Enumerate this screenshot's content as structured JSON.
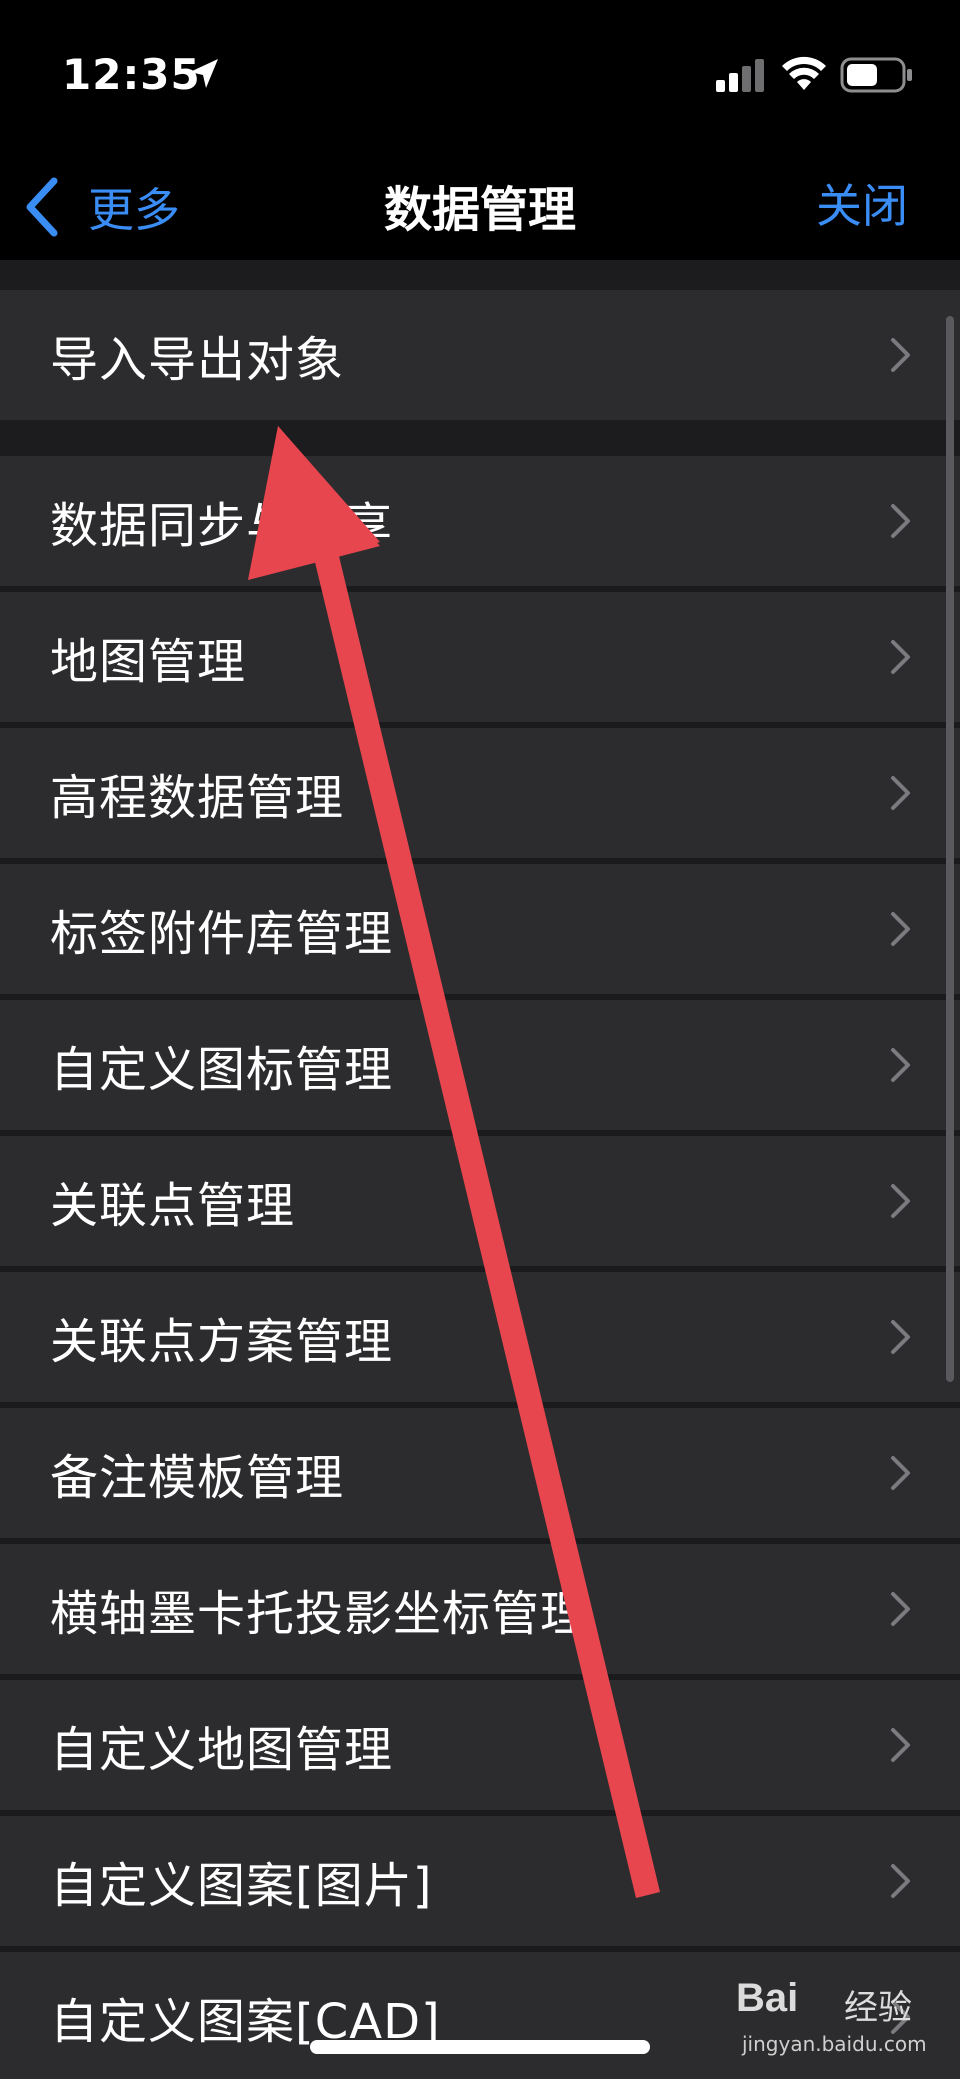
{
  "status_bar": {
    "time": "12:35",
    "icons": [
      "location-arrow-icon",
      "cellular-signal-icon",
      "wifi-icon",
      "battery-icon"
    ]
  },
  "nav": {
    "back_label": "更多",
    "title": "数据管理",
    "close_label": "关闭"
  },
  "colors": {
    "accent": "#3a8df5",
    "row_bg": "#2c2c2e",
    "annotation_arrow": "#e8464f"
  },
  "rows_group1": [
    {
      "label": "导入导出对象"
    }
  ],
  "rows_group2": [
    {
      "label": "数据同步与分享"
    },
    {
      "label": "地图管理"
    },
    {
      "label": "高程数据管理"
    },
    {
      "label": "标签附件库管理"
    },
    {
      "label": "自定义图标管理"
    },
    {
      "label": "关联点管理"
    },
    {
      "label": "关联点方案管理"
    },
    {
      "label": "备注模板管理"
    },
    {
      "label": "横轴墨卡托投影坐标管理"
    },
    {
      "label": "自定义地图管理"
    },
    {
      "label": "自定义图案[图片]"
    },
    {
      "label": "自定义图案[CAD]"
    }
  ],
  "watermark": {
    "logo": "Bai",
    "text": "经验",
    "url": "jingyan.baidu.com"
  }
}
